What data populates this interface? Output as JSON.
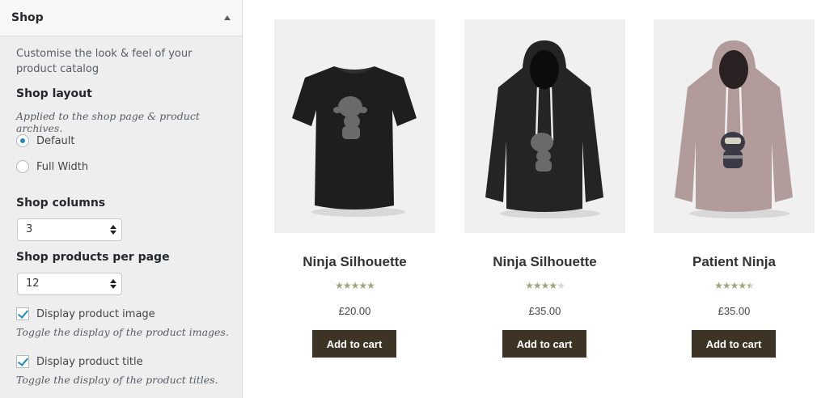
{
  "sidebar": {
    "section_title": "Shop",
    "description": "Customise the look & feel of your product catalog",
    "layout": {
      "title": "Shop layout",
      "description": "Applied to the shop page & product archives.",
      "options": [
        {
          "label": "Default",
          "checked": true
        },
        {
          "label": "Full Width",
          "checked": false
        }
      ]
    },
    "columns": {
      "title": "Shop columns",
      "value": "3"
    },
    "per_page": {
      "title": "Shop products per page",
      "value": "12"
    },
    "display_image": {
      "label": "Display product image",
      "description": "Toggle the display of the product images.",
      "checked": true
    },
    "display_title": {
      "label": "Display product title",
      "description": "Toggle the display of the product titles.",
      "checked": true
    }
  },
  "products": [
    {
      "name": "Ninja Silhouette",
      "price": "£20.00",
      "rating": 5,
      "button": "Add to cart",
      "image": "black-tshirt-image",
      "garment_color": "#1e1e1e"
    },
    {
      "name": "Ninja Silhouette",
      "price": "£35.00",
      "rating": 4,
      "button": "Add to cart",
      "image": "black-hoodie-image",
      "garment_color": "#242424"
    },
    {
      "name": "Patient Ninja",
      "price": "£35.00",
      "rating": 4.5,
      "button": "Add to cart",
      "image": "pink-hoodie-image",
      "garment_color": "#b29b9b"
    }
  ],
  "colors": {
    "button_bg": "#3d3426",
    "star": "#a0a57c",
    "accent": "#1e8cbe"
  }
}
